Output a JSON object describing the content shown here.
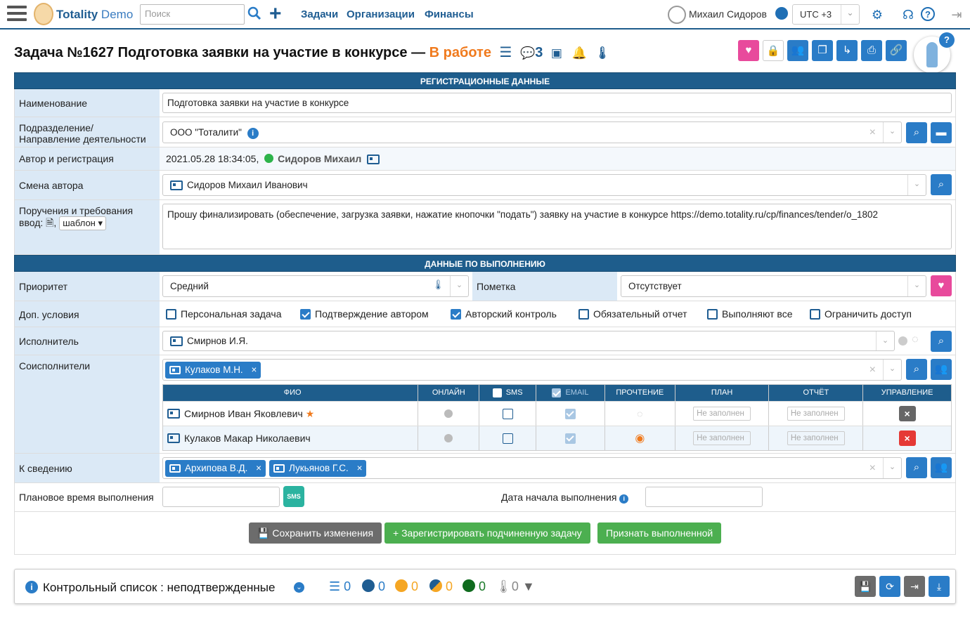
{
  "app": {
    "name": "Totality",
    "name_accent": "Demo"
  },
  "header": {
    "search_placeholder": "Поиск",
    "nav": [
      "Задачи",
      "Организации",
      "Финансы"
    ],
    "user": "Михаил Сидоров",
    "timezone": "UTC +3"
  },
  "task": {
    "title": "Задача №1627 Подготовка заявки на участие в конкурсе —",
    "status": "В работе",
    "comments_count": "3"
  },
  "sections": {
    "registration": "РЕГИСТРАЦИОННЫЕ ДАННЫЕ",
    "execution": "ДАННЫЕ ПО ВЫПОЛНЕНИЮ"
  },
  "fields": {
    "name_label": "Наименование",
    "name_value": "Подготовка заявки на участие в конкурсе",
    "dept_label_1": "Подразделение/",
    "dept_label_2": "Направление деятельности",
    "dept_value": "ООО \"Тоталити\"",
    "author_label": "Автор и регистрация",
    "author_date": "2021.05.28 18:34:05,",
    "author_name": "Сидоров Михаил",
    "change_author_label": "Смена автора",
    "change_author_value": "Сидоров Михаил Иванович",
    "orders_label": "Поручения и требования",
    "orders_label_2": "ввод:",
    "template_label": "шаблон",
    "orders_value": "Прошу финализировать (обеспечение, загрузка заявки, нажатие кнопочки \"подать\") заявку на участие в конкурсе https://demo.totality.ru/cp/finances/tender/o_1802",
    "priority_label": "Приоритет",
    "priority_value": "Средний",
    "mark_label": "Пометка",
    "mark_value": "Отсутствует",
    "extra_label": "Доп. условия",
    "options": [
      {
        "label": "Персональная задача",
        "checked": false
      },
      {
        "label": "Подтверждение автором",
        "checked": true
      },
      {
        "label": "Авторский контроль",
        "checked": true
      },
      {
        "label": "Обязательный отчет",
        "checked": false
      },
      {
        "label": "Выполняют все",
        "checked": false
      },
      {
        "label": "Ограничить доступ",
        "checked": false
      }
    ],
    "executor_label": "Исполнитель",
    "executor_value": "Смирнов И.Я.",
    "coexec_label": "Соисполнители",
    "coexec_tag": "Кулаков М.Н.",
    "info_label": "К сведению",
    "info_tags": [
      "Архипова В.Д.",
      "Лукьянов Г.С."
    ],
    "plan_time_label": "Плановое время выполнения",
    "start_date_label": "Дата начала выполнения"
  },
  "participants": {
    "headers": [
      "ФИО",
      "ОНЛАЙН",
      "SMS",
      "EMAIL",
      "ПРОЧТЕНИЕ",
      "ПЛАН",
      "ОТЧЁТ",
      "УПРАВЛЕНИЕ"
    ],
    "rows": [
      {
        "name": "Смирнов Иван Яковлевич",
        "plan": "Не заполнен",
        "report": "Не заполнен"
      },
      {
        "name": "Кулаков Макар Николаевич",
        "plan": "Не заполнен",
        "report": "Не заполнен"
      }
    ]
  },
  "actions": {
    "save": "Сохранить изменения",
    "register_sub": "Зарегистрировать подчиненную задачу",
    "mark_done": "Признать выполненной"
  },
  "checklist": {
    "title": "Контрольный список : неподтвержденные",
    "counts": [
      "0",
      "0",
      "0",
      "0",
      "0",
      "0"
    ]
  },
  "colors": {
    "primary": "#2a7cc7",
    "header": "#1e5d8c",
    "status": "#f07a1d",
    "green": "#4caf50",
    "pink": "#e84a9c",
    "red": "#e53935"
  }
}
